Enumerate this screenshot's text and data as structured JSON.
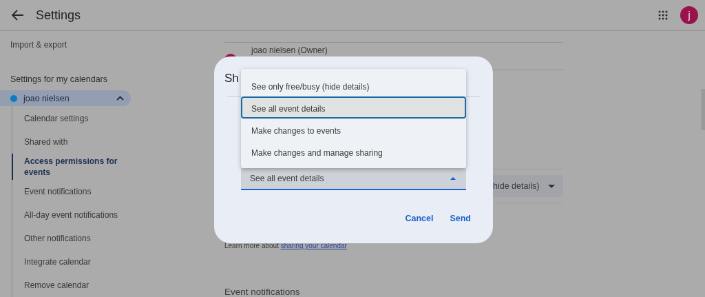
{
  "header": {
    "title": "Settings",
    "avatar_letter": "j"
  },
  "sidebar": {
    "items": [
      {
        "label": "Import & export"
      }
    ],
    "section_title": "Settings for my calendars",
    "calendar": {
      "name": "joao nielsen",
      "expanded": true,
      "children": [
        {
          "label": "Calendar settings",
          "selected": false
        },
        {
          "label": "Shared with",
          "selected": false
        },
        {
          "label": "Access permissions for events",
          "selected": true
        },
        {
          "label": "Event notifications",
          "selected": false
        },
        {
          "label": "All-day event notifications",
          "selected": false
        },
        {
          "label": "Other notifications",
          "selected": false
        },
        {
          "label": "Integrate calendar",
          "selected": false
        },
        {
          "label": "Remove calendar",
          "selected": false
        }
      ]
    }
  },
  "main": {
    "owner": "joao nielsen (Owner)",
    "permission_value": "hide details)",
    "learn_more": {
      "text": "Learn more about",
      "link": "sharing your calendar"
    },
    "next_section": "Event notifications"
  },
  "dialog": {
    "title": "Sh",
    "expanded": true,
    "menu": [
      {
        "label": "See only free/busy (hide details)",
        "selected": false
      },
      {
        "label": "See all event details",
        "selected": true
      },
      {
        "label": "Make changes to events",
        "selected": false
      },
      {
        "label": "Make changes and manage sharing",
        "selected": false
      }
    ],
    "select_value": "See all event details",
    "buttons": [
      "Cancel",
      "Send"
    ]
  }
}
